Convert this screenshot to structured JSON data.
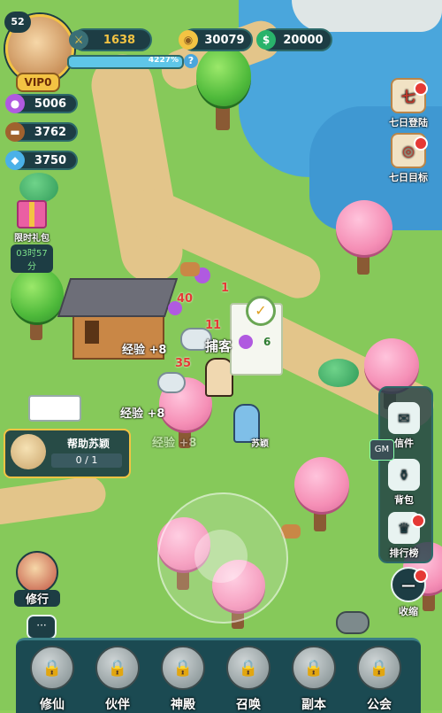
{
  "player": {
    "level": "52",
    "vip": "VIP0",
    "power": "1638",
    "exp_percent": "4227%"
  },
  "currency": {
    "gold": "30079",
    "jade": "20000"
  },
  "resources": [
    {
      "icon": "orb-icon",
      "value": "5006"
    },
    {
      "icon": "wood-icon",
      "value": "3762"
    },
    {
      "icon": "crystal-icon",
      "value": "3750"
    }
  ],
  "gift": {
    "label": "限时礼包",
    "timer": "03时57分"
  },
  "right_menu": {
    "login7": "七日登陆",
    "goal7": "七日目标",
    "mail": "信件",
    "bag": "背包",
    "rank": "排行榜",
    "collapse": "收缩"
  },
  "quest": {
    "title": "帮助苏颖",
    "progress": "0 / 1"
  },
  "map_texts": {
    "exp1": "经验 +8",
    "exp2": "经验 +8",
    "exp3": "经验 +8",
    "catcher": "捕客",
    "npc": "苏颖",
    "dmg1": "40",
    "dmg2": "1",
    "dmg3": "11",
    "dmg4": "35",
    "num_green": "6",
    "gm": "GM",
    "cultivate": "修行"
  },
  "dock": [
    "修仙",
    "伙伴",
    "神殿",
    "召唤",
    "副本",
    "公会"
  ],
  "colors": {
    "hud_bg": "#1d3d44",
    "accent_gold": "#f3c343",
    "red_dot": "#e53935"
  }
}
